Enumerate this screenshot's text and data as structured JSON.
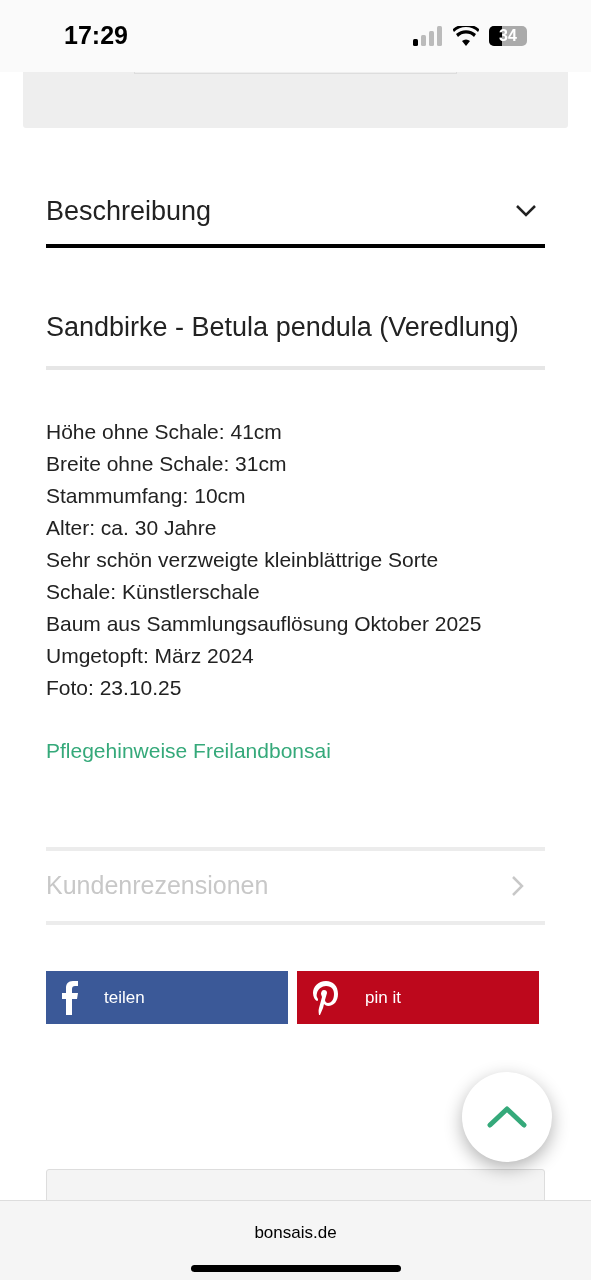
{
  "status_bar": {
    "time": "17:29",
    "battery": "34"
  },
  "description_section": {
    "title": "Beschreibung",
    "expanded": true,
    "product_title": "Sandbirke - Betula pendula (Veredlung)",
    "details": [
      "Höhe ohne Schale: 41cm",
      "Breite ohne Schale: 31cm",
      "Stammumfang: 10cm",
      "Alter: ca. 30 Jahre",
      "Sehr schön verzweigte kleinblättrige Sorte",
      "Schale: Künstlerschale",
      "Baum aus Sammlungsauflösung Oktober 2025",
      "Umgetopft: März 2024",
      "Foto: 23.10.25"
    ],
    "care_link": "Pflegehinweise Freilandbonsai"
  },
  "reviews_section": {
    "title": "Kundenrezensionen",
    "disabled": true
  },
  "share_buttons": [
    {
      "kind": "facebook",
      "label": "teilen"
    },
    {
      "kind": "pinterest",
      "label": "pin it"
    }
  ],
  "browser_bar": {
    "url": "bonsais.de"
  }
}
